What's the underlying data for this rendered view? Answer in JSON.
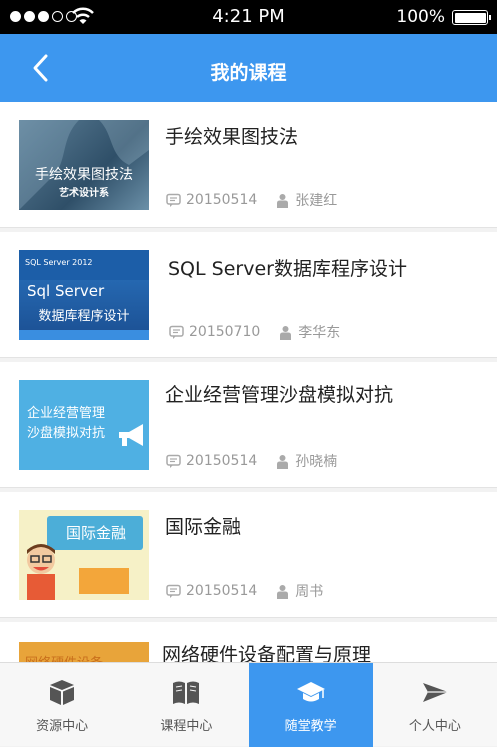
{
  "status": {
    "time": "4:21 PM",
    "battery": "100%"
  },
  "header": {
    "title": "我的课程"
  },
  "courses": [
    {
      "title": "手绘效果图技法",
      "date": "20150514",
      "teacher": "张建红",
      "thumb_text": "手绘效果图技法",
      "thumb_sub": "艺术设计系"
    },
    {
      "title": "SQL Server数据库程序设计",
      "date": "20150710",
      "teacher": "李华东",
      "thumb_text": "Sql Server",
      "thumb_sub": "数据库程序设计",
      "thumb_logo": "SQL Server 2012"
    },
    {
      "title": "企业经营管理沙盘模拟对抗",
      "date": "20150514",
      "teacher": "孙晓楠",
      "thumb_text": "企业经营管理",
      "thumb_sub": "沙盘模拟对抗"
    },
    {
      "title": "国际金融",
      "date": "20150514",
      "teacher": "周书",
      "thumb_text": "国际金融"
    },
    {
      "title": "网络硬件设备配置与原理",
      "thumb_text": "网络硬件设备"
    }
  ],
  "tabs": [
    {
      "label": "资源中心",
      "icon": "box-icon"
    },
    {
      "label": "课程中心",
      "icon": "book-icon"
    },
    {
      "label": "随堂教学",
      "icon": "graduation-cap-icon",
      "active": true
    },
    {
      "label": "个人中心",
      "icon": "paper-plane-icon"
    }
  ],
  "colors": {
    "accent": "#3d97ef"
  }
}
